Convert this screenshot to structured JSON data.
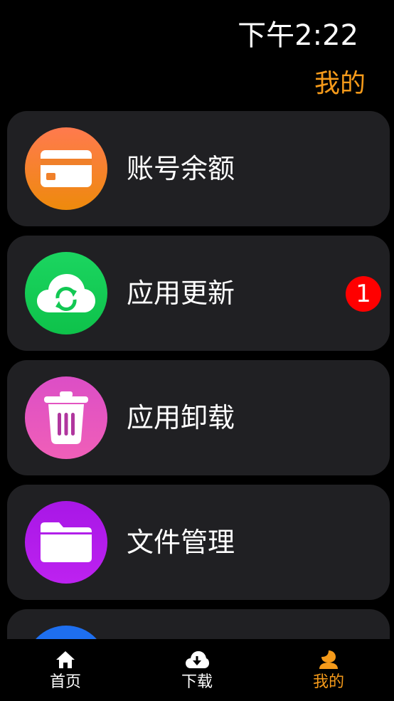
{
  "status_bar": {
    "time": "下午2:22"
  },
  "header": {
    "title": "我的"
  },
  "menu": {
    "items": [
      {
        "label": "账号余额",
        "icon": "wallet-card-icon",
        "color_top": "#ff7a4e",
        "color_bottom": "#ee8a0c"
      },
      {
        "label": "应用更新",
        "icon": "cloud-sync-icon",
        "color_top": "#1bd560",
        "color_bottom": "#0ec24a",
        "badge": "1"
      },
      {
        "label": "应用卸载",
        "icon": "trash-icon",
        "color_top": "#dc4ec6",
        "color_bottom": "#f05fb8"
      },
      {
        "label": "文件管理",
        "icon": "folder-icon",
        "color_top": "#a817e6",
        "color_bottom": "#bd22f0"
      },
      {
        "label": "",
        "icon": "partial-icon",
        "color_top": "#1e6ff0",
        "color_bottom": "#1e6ff0"
      }
    ]
  },
  "bottom_nav": {
    "items": [
      {
        "label": "首页",
        "icon": "home-icon",
        "active": false
      },
      {
        "label": "下载",
        "icon": "cloud-download-icon",
        "active": false
      },
      {
        "label": "我的",
        "icon": "person-icon",
        "active": true
      }
    ],
    "active_color": "#f59a1a",
    "inactive_color": "#ffffff"
  },
  "colors": {
    "accent": "#f59a1a",
    "card_bg": "#202023",
    "badge": "#ff0000"
  }
}
